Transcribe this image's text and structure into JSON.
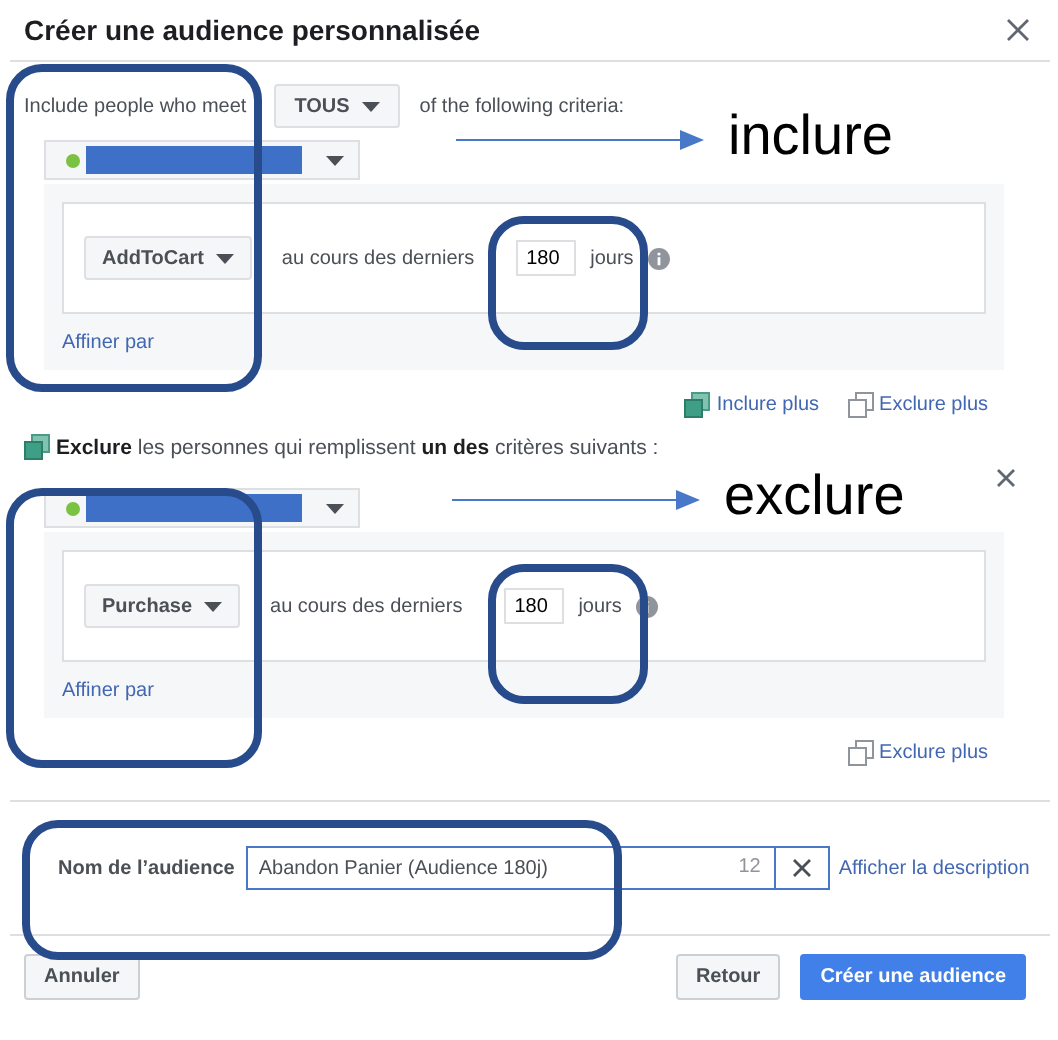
{
  "dialog": {
    "title": "Créer une audience personnalisée"
  },
  "include": {
    "prefix": "Include people who meet",
    "match": "TOUS",
    "suffix": "of the following criteria:",
    "event": "AddToCart",
    "period_label": "au cours des derniers",
    "days": "180",
    "days_unit": "jours",
    "refine": "Affiner par"
  },
  "include_links": [
    {
      "label": "Inclure plus",
      "kind": "include"
    },
    {
      "label": "Exclure plus",
      "kind": "exclude"
    }
  ],
  "exclude": {
    "sentence": "**Exclure** les personnes qui remplissent **un des** critères suivants :",
    "event": "Purchase",
    "period_label": "au cours des derniers",
    "days": "180",
    "days_unit": "jours",
    "refine": "Affiner par"
  },
  "exclude_links": [
    {
      "label": "Exclure plus",
      "kind": "exclude"
    }
  ],
  "audience_name": {
    "label": "Nom de l’audience",
    "value": "Abandon Panier (Audience 180j)",
    "counter": "12",
    "link": "Afficher la description"
  },
  "buttons": [
    {
      "label": "Annuler",
      "kind": "secondary"
    },
    {
      "label": "Retour",
      "kind": "secondary"
    },
    {
      "label": "Créer une audience",
      "kind": "primary"
    }
  ],
  "annotations": [
    {
      "label": "inclure"
    },
    {
      "label": "exclure"
    }
  ]
}
